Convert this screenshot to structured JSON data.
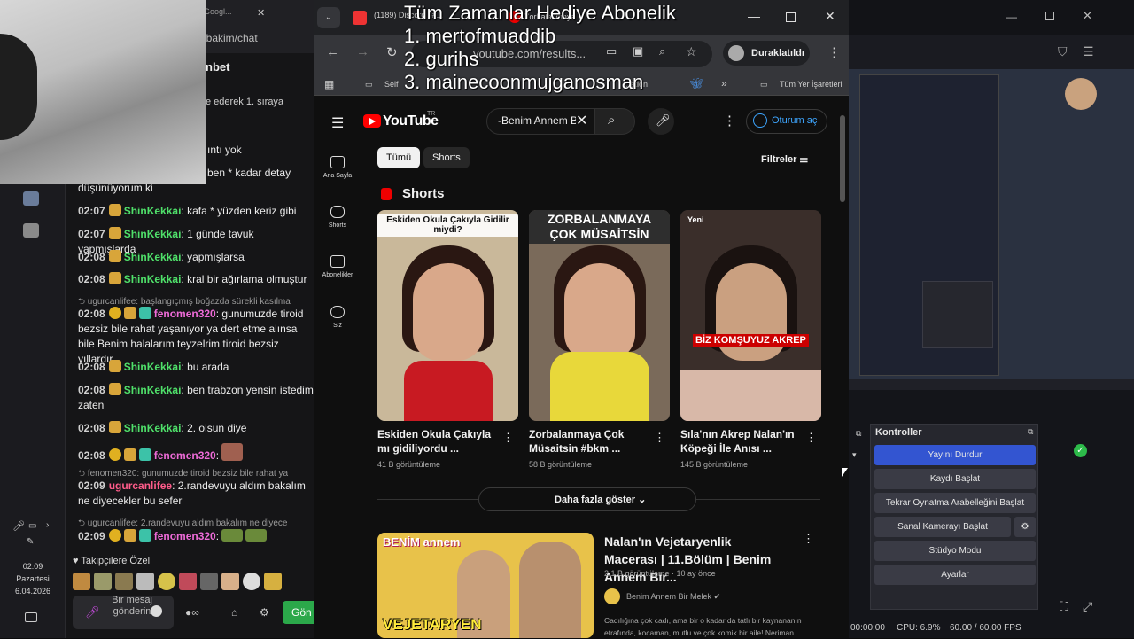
{
  "overlay": {
    "title": "Tüm Zamanlar Hediye Abonelik",
    "entries": [
      "1. mertofmuaddib",
      "2. gurihs",
      "3. mainecoonmujganosman"
    ]
  },
  "taskbar": {
    "time": "02:09",
    "day": "Pazartesi",
    "date": "6.04.2026"
  },
  "chat": {
    "tab_title": "Googl...",
    "url": "lbakim/chat",
    "title": "nbet",
    "pinned": "e ederek 1. sıraya",
    "partial_lines": [
      "ıntı yok",
      "ben * kadar detay",
      "düşünüyorum ki"
    ],
    "messages": [
      {
        "time": "02:07",
        "user": "ShinKekkai",
        "text": "kafa * yüzden keriz gibi"
      },
      {
        "time": "02:07",
        "user": "ShinKekkai",
        "text": "1 günde tavuk yapmışlarda"
      },
      {
        "time": "02:08",
        "user": "ShinKekkai",
        "text": "yapmışlarsa"
      },
      {
        "time": "02:08",
        "user": "ShinKekkai",
        "text": "kral bir ağırlama olmuştur"
      }
    ],
    "reply1": "ugurcanlifee: başlangıçmış boğazda sürekli kasılma",
    "msg_fenomen1": {
      "time": "02:08",
      "user": "fenomen320",
      "text": "gunumuzde tiroid bezsiz bile rahat yaşanıyor ya dert etme alınsa bile Benim halalarım teyzelrim tiroid bezsiz yıllardır"
    },
    "messages2": [
      {
        "time": "02:08",
        "user": "ShinKekkai",
        "text": "bu arada"
      },
      {
        "time": "02:08",
        "user": "ShinKekkai",
        "text": "ben trabzon yensin istedim zaten"
      },
      {
        "time": "02:08",
        "user": "ShinKekkai",
        "text": "2. olsun diye"
      }
    ],
    "msg_fenomen2": {
      "time": "02:08",
      "user": "fenomen320",
      "text": ""
    },
    "reply2": "fenomen320: gunumuzde tiroid bezsiz bile rahat ya",
    "msg_ugur": {
      "time": "02:09",
      "user": "ugurcanlifee",
      "text": "2.randevuyu aldım bakalım ne diyecekler bu sefer"
    },
    "reply3": "ugurcanlifee: 2.randevuyu aldım bakalım ne diyece",
    "msg_fenomen3": {
      "time": "02:09",
      "user": "fenomen320",
      "text": ""
    },
    "followers_label": "Takipçilere Özel",
    "input_placeholder": "Bir mesaj gönderin",
    "send_label": "Gön"
  },
  "browser": {
    "tab1": "(1189) Discord | #...",
    "tab2": "Zorbalanmaya...",
    "url": "youtube.com/results...",
    "profile": "Duraklatıldı",
    "bookmarks": [
      "Self",
      "...ation",
      "Tüm Yer İşaretleri"
    ]
  },
  "youtube": {
    "logo": "YouTube",
    "region": "TR",
    "search": "-Benim Annem Bir Melek",
    "signin": "Oturum aç",
    "sidebar": [
      "Ana Sayfa",
      "Shorts",
      "Abonelikler",
      "Siz"
    ],
    "chips": [
      "Tümü",
      "Shorts"
    ],
    "filters": "Filtreler",
    "shorts_title": "Shorts",
    "shorts": [
      {
        "caption": "Eskiden Okula Çakıyla Gidilir miydi?",
        "title": "Eskiden Okula Çakıyla mı gidiliyordu ...",
        "views": "41 B görüntüleme"
      },
      {
        "caption": "ZORBALANMAYA ÇOK MÜSAİTSİN",
        "title": "Zorbalanmaya Çok Müsaitsin #bkm ...",
        "views": "58 B görüntüleme"
      },
      {
        "caption": "Yeni",
        "overlay": "BİZ KOMŞUYUZ AKREP",
        "title": "Sıla'nın Akrep Nalan'ın Köpeği İle Anısı ...",
        "views": "145 B görüntüleme"
      }
    ],
    "more_button": "Daha fazla göster",
    "video": {
      "thumb_logo": "BENİM annem",
      "thumb_title": "VEJETARYEN",
      "title": "Nalan'ın Vejetaryenlik Macerası | 11.Bölüm | Benim Annem Bir...",
      "meta": "2,1 B görüntüleme · 10 ay önce",
      "channel": "Benim Annem Bir Melek",
      "desc": "Cadılığına çok cadı, ama bir o kadar da tatlı bir kaynananın etrafında, kocaman, mutlu ve çok komik bir aile! Neriman..."
    }
  },
  "obs": {
    "panel_title": "Kontroller",
    "buttons": [
      "Yayını Durdur",
      "Kaydı Başlat",
      "Tekrar Oynatma Arabelleğini Başlat",
      "Sanal Kamerayı Başlat",
      "Stüdyo Modu",
      "Ayarlar"
    ],
    "status_time": "00:00:00",
    "cpu": "CPU: 6.9%",
    "fps": "60.00 / 60.00 FPS"
  }
}
